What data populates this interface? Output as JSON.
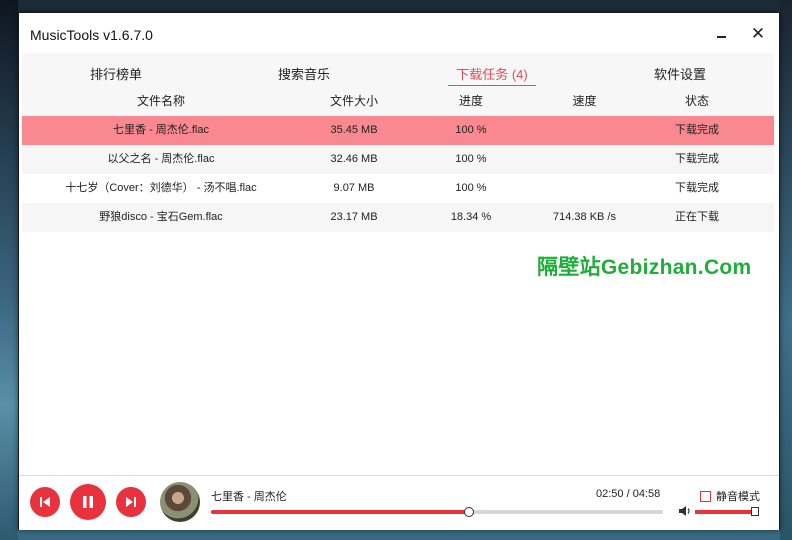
{
  "window": {
    "title": "MusicTools v1.6.7.0",
    "minimize": "–",
    "close": "✕"
  },
  "tabs": [
    {
      "label": "排行榜单",
      "active": false
    },
    {
      "label": "搜索音乐",
      "active": false
    },
    {
      "label": "下载任务 (4)",
      "active": true
    },
    {
      "label": "软件设置",
      "active": false
    }
  ],
  "table": {
    "headers": [
      "文件名称",
      "文件大小",
      "进度",
      "速度",
      "状态"
    ],
    "rows": [
      {
        "name": "七里香 - 周杰伦.flac",
        "size": "35.45 MB",
        "progress": "100 %",
        "speed": "",
        "status": "下载完成"
      },
      {
        "name": "以父之名 - 周杰伦.flac",
        "size": "32.46 MB",
        "progress": "100 %",
        "speed": "",
        "status": "下载完成"
      },
      {
        "name": "十七岁（Cover：刘德华） - 汤不唱.flac",
        "size": "9.07 MB",
        "progress": "100 %",
        "speed": "",
        "status": "下载完成"
      },
      {
        "name": "野狼disco - 宝石Gem.flac",
        "size": "23.17 MB",
        "progress": "18.34 %",
        "speed": "714.38 KB /s",
        "status": "正在下载"
      }
    ]
  },
  "watermark": "隔壁站Gebizhan.Com",
  "player": {
    "track": "七里香 - 周杰伦",
    "time": "02:50 / 04:58",
    "progress_fraction": 0.57,
    "mute_label": "静音模式",
    "muted": false,
    "volume_fraction": 0.97,
    "accent": "#e8323e",
    "icons": {
      "prev": "skip-previous-icon",
      "pause": "pause-icon",
      "next": "skip-next-icon",
      "volume": "speaker-icon"
    }
  }
}
